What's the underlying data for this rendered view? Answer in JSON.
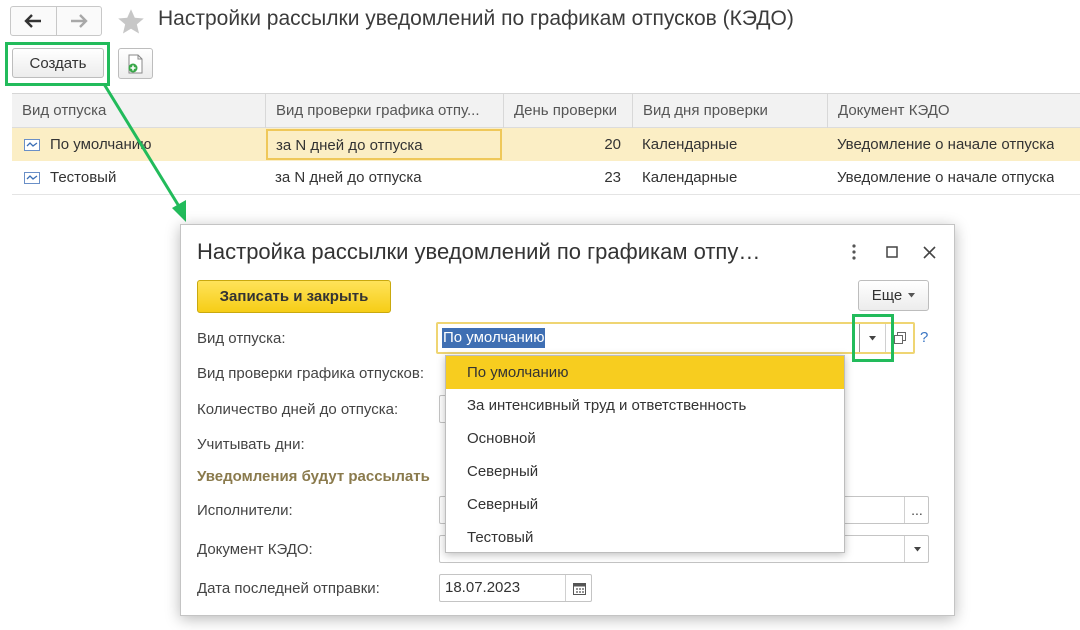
{
  "window": {
    "title": "Настройки рассылки уведомлений по графикам отпусков (КЭДО)"
  },
  "toolbar": {
    "create_label": "Создать"
  },
  "list": {
    "columns": [
      "Вид отпуска",
      "Вид проверки графика отпу...",
      "День проверки",
      "Вид дня проверки",
      "Документ КЭДО"
    ],
    "rows": [
      {
        "vacation_type": "По умолчанию",
        "check_type": "за N дней до отпуска",
        "check_day": "20",
        "day_type": "Календарные",
        "document": "Уведомление о начале отпуска",
        "selected": true
      },
      {
        "vacation_type": "Тестовый",
        "check_type": "за N дней до отпуска",
        "check_day": "23",
        "day_type": "Календарные",
        "document": "Уведомление о начале отпуска",
        "selected": false
      }
    ]
  },
  "dialog": {
    "title": "Настройка рассылки уведомлений по графикам отпу…",
    "save_label": "Записать и закрыть",
    "more_label": "Еще",
    "help_label": "?",
    "fields": {
      "vacation_type_label": "Вид отпуска:",
      "vacation_type_value": "По умолчанию",
      "check_type_label": "Вид проверки графика отпусков:",
      "days_before_label": "Количество дней до отпуска:",
      "count_days_label": "Учитывать дни:",
      "section_label": "Уведомления будут рассылать",
      "executors_label": "Исполнители:",
      "document_label": "Документ КЭДО:",
      "last_sent_label": "Дата последней отправки:",
      "last_sent_value": "18.07.2023",
      "ellipsis_label": "..."
    }
  },
  "dropdown": {
    "items": [
      "По умолчанию",
      "За интенсивный труд и ответственность",
      "Основной",
      "Северный",
      "Северный",
      "Тестовый"
    ],
    "selected_index": 0
  },
  "colors": {
    "annotation_green": "#22bb5b",
    "selected_row": "#fbeec5",
    "dropdown_selected": "#f7cd1f",
    "save_button": "#f6cd16",
    "section_label": "#8a7a4c"
  },
  "icons": [
    "arrow-left-icon",
    "arrow-right-icon",
    "star-icon",
    "new-document-icon",
    "list-item-icon",
    "more-vertical-icon",
    "maximize-icon",
    "close-icon",
    "chevron-down-icon",
    "open-icon",
    "calendar-icon"
  ]
}
